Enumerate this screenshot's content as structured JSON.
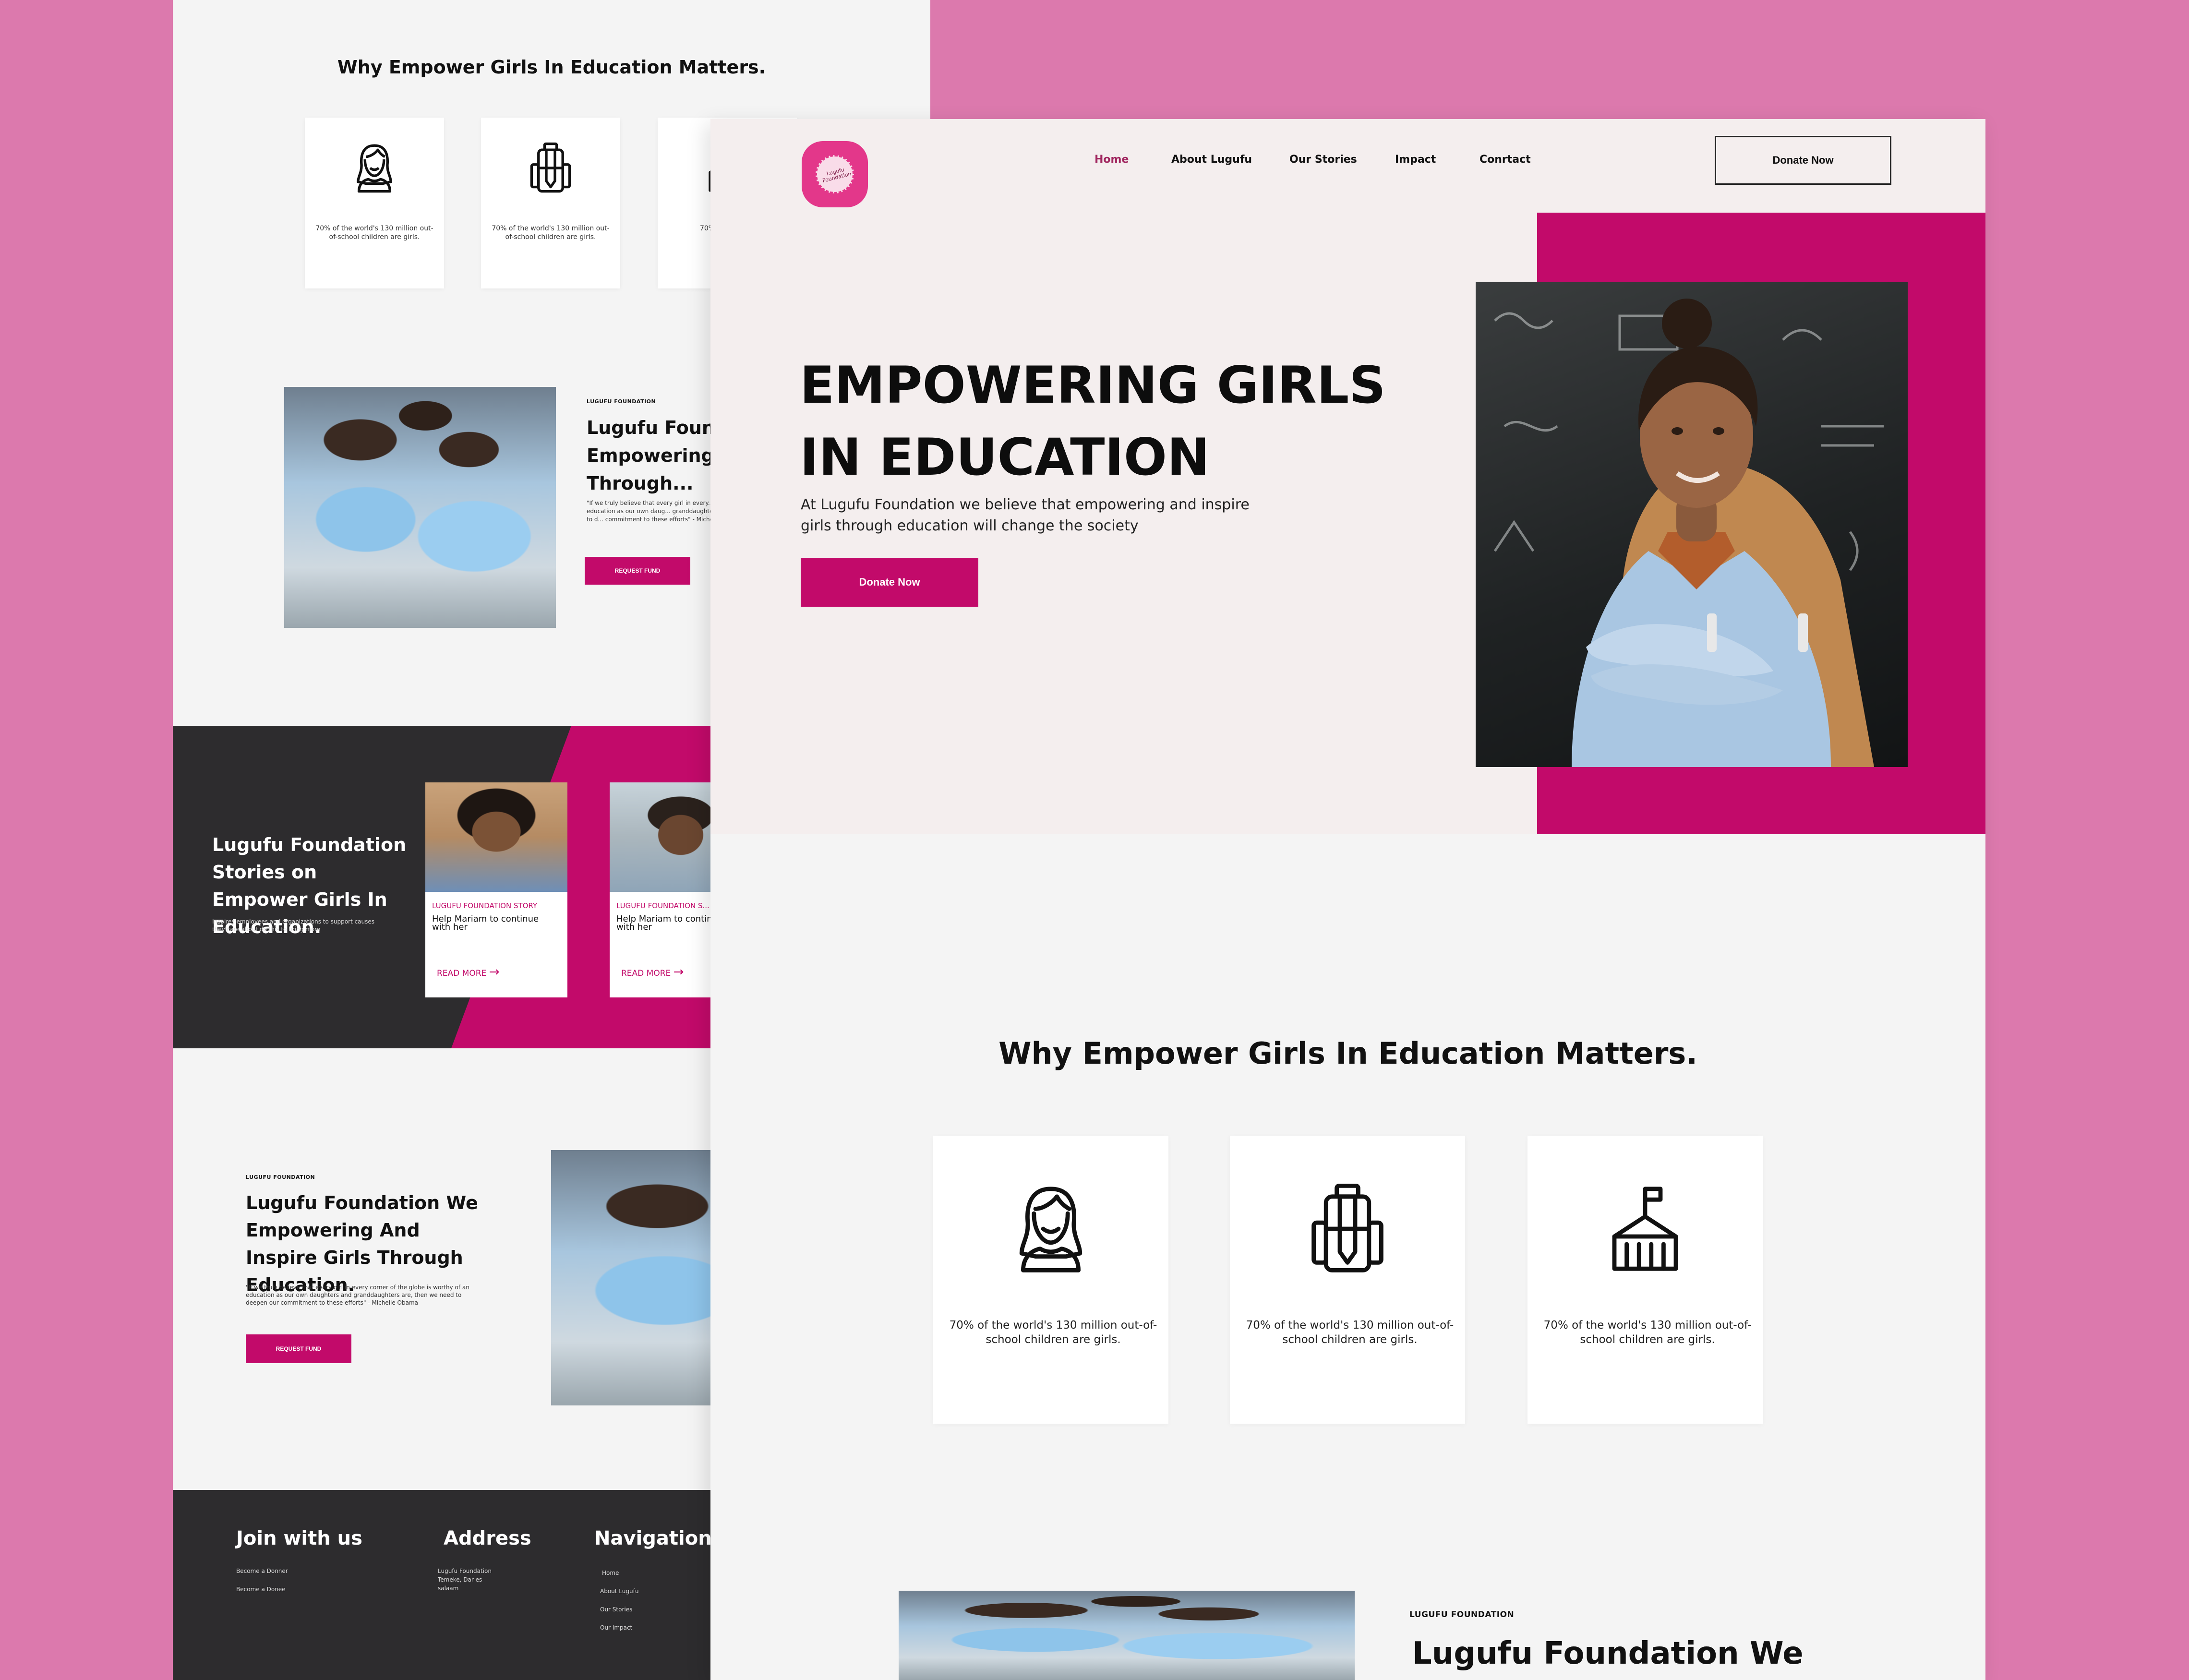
{
  "colors": {
    "background": "#dc79ad",
    "accent": "#c20a6a",
    "logo": "#e3378a",
    "dark": "#2d2c2e"
  },
  "back": {
    "why_title": "Why Empower Girls In Education Matters.",
    "cards": [
      {
        "icon": "girl-icon",
        "text": "70% of the world's 130 million out-of-school children are girls."
      },
      {
        "icon": "backpack-icon",
        "text": "70% of the world's 130 million out-of-school children are girls."
      },
      {
        "icon": "school-icon",
        "text": "70% of th... sc..."
      }
    ],
    "intro": {
      "eyebrow": "LUGUFU FOUNDATION",
      "heading": "Lugufu Found... Empowering Girls Through...",
      "quote": "\"If we truly believe that every girl in every... worthy of an education as our own daug... granddaughters are, then we need to d... commitment to these efforts\" - Michelle...",
      "button": "REQUEST FUND"
    },
    "stories": {
      "title": "Lugufu Foundation Stories on Empower Girls In Education.",
      "description": "Inspires employees and organizations to support causes they care about do this to bring more",
      "cards": [
        {
          "eyebrow": "LUGUFU FOUNDATION STORY",
          "title": "Help Mariam to continue with her",
          "more": "READ MORE"
        },
        {
          "eyebrow": "LUGUFU FOUNDATION S...",
          "title": "Help Mariam to continue with her",
          "more": "READ MORE"
        }
      ]
    },
    "second": {
      "eyebrow": "LUGUFU FOUNDATION",
      "heading": "Lugufu Foundation We Empowering And Inspire Girls Through Education.",
      "quote": "\"If we truly believe that every girl in every corner of the globe is worthy of an education as our own daughters and granddaughters are, then we need to deepen our commitment to these efforts\" - Michelle Obama",
      "button": "REQUEST FUND"
    },
    "footer": {
      "join": {
        "title": "Join with us",
        "items": [
          "Become a Donner",
          "Become a Donee"
        ]
      },
      "address": {
        "title": "Address",
        "lines": [
          "Lugufu Foundation",
          "Temeke, Dar es",
          "salaam"
        ]
      },
      "navigation": {
        "title": "Navigation",
        "items": [
          "Home",
          "About Lugufu",
          "Our Stories",
          "Our Impact"
        ]
      }
    }
  },
  "front": {
    "logo_text": "Lugufu Foundation",
    "nav": {
      "home": "Home",
      "about": "About Lugufu",
      "stories": "Our Stories",
      "impact": "Impact",
      "contact": "Conrtact"
    },
    "header_donate": "Donate Now",
    "hero": {
      "title_line1": "EMPOWERING GIRLS",
      "title_line2": "IN EDUCATION",
      "subtitle": "At Lugufu Foundation we believe that empowering and inspire girls through education will change the society",
      "button": "Donate Now"
    },
    "why_title": "Why Empower Girls In Education Matters.",
    "cards": [
      {
        "icon": "girl-icon",
        "text": "70% of the world's 130 million out-of-school children are girls."
      },
      {
        "icon": "backpack-icon",
        "text": "70% of the world's 130 million out-of-school children are girls."
      },
      {
        "icon": "school-icon",
        "text": "70% of the world's 130 million out-of-school children are girls."
      }
    ],
    "intro": {
      "eyebrow": "LUGUFU FOUNDATION",
      "heading": "Lugufu Foundation We"
    }
  }
}
